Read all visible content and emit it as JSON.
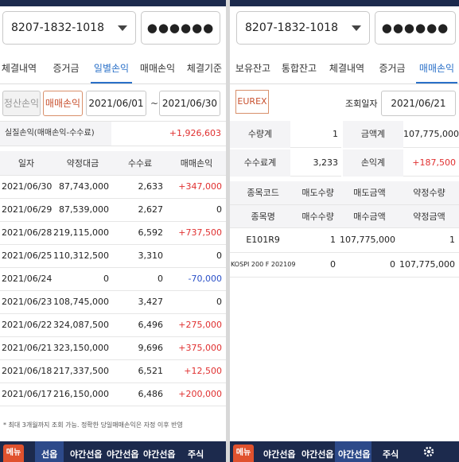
{
  "left": {
    "account": "8207-1832-1018",
    "password_mask": "●●●●●●",
    "tabs": [
      "체결내역",
      "증거금",
      "일별손익",
      "매매손익",
      "체결기준"
    ],
    "active_tab": "일별손익",
    "subtabs": [
      "정산손익",
      "매매손익"
    ],
    "date_from": "2021/06/01",
    "date_sep": "~",
    "date_to": "2021/06/30",
    "summary_label": "실질손익(매매손익-수수료)",
    "summary_value": "+1,926,603",
    "columns": [
      "일자",
      "약정대금",
      "수수료",
      "매매손익"
    ],
    "rows": [
      [
        "2021/06/30",
        "87,743,000",
        "2,633",
        "+347,000"
      ],
      [
        "2021/06/29",
        "87,539,000",
        "2,627",
        "0"
      ],
      [
        "2021/06/28",
        "219,115,000",
        "6,592",
        "+737,500"
      ],
      [
        "2021/06/25",
        "110,312,500",
        "3,310",
        "0"
      ],
      [
        "2021/06/24",
        "0",
        "0",
        "-70,000"
      ],
      [
        "2021/06/23",
        "108,745,000",
        "3,427",
        "0"
      ],
      [
        "2021/06/22",
        "324,087,500",
        "6,496",
        "+275,000"
      ],
      [
        "2021/06/21",
        "323,150,000",
        "9,696",
        "+375,000"
      ],
      [
        "2021/06/18",
        "217,337,500",
        "6,521",
        "+12,500"
      ],
      [
        "2021/06/17",
        "216,150,000",
        "6,486",
        "+200,000"
      ]
    ],
    "note": "* 최대 3개월까지 조회 가능. 정확한 당일매매손익은 자정 이후 반영",
    "bottom_badge": "메뉴",
    "bottom_items": [
      "선옵",
      "야간선옵",
      "야간선옵",
      "야간선옵",
      "주식"
    ]
  },
  "right": {
    "account": "8207-1832-1018",
    "password_mask": "●●●●●●",
    "tabs": [
      "보유잔고",
      "통합잔고",
      "체결내역",
      "증거금",
      "매매손익"
    ],
    "active_tab": "매매손익",
    "market_button": "EUREX",
    "query_date_label": "조회일자",
    "query_date": "2021/06/21",
    "info": {
      "qty_label": "수량계",
      "qty_value": "1",
      "amount_label": "금액계",
      "amount_value": "107,775,000",
      "fee_label": "수수료계",
      "fee_value": "3,233",
      "pnl_label": "손익계",
      "pnl_value": "+187,500"
    },
    "header_row1": [
      "종목코드",
      "매도수량",
      "매도금액",
      "약정수량"
    ],
    "header_row2": [
      "종목명",
      "매수수량",
      "매수금액",
      "약정금액"
    ],
    "rows": [
      [
        "E101R9",
        "1",
        "107,775,000",
        "1"
      ],
      [
        "KOSPI 200 F 202109",
        "0",
        "0",
        "107,775,000"
      ]
    ],
    "bottom_badge": "메뉴",
    "bottom_items": [
      "야간선옵",
      "야간선옵",
      "야간선옵",
      "주식"
    ]
  },
  "colors": {
    "accent_blue": "#2a70c8",
    "profit_red": "#e03030",
    "loss_blue": "#2a50c8",
    "navbar": "#1c2a4d",
    "menu_orange": "#e0522e"
  }
}
